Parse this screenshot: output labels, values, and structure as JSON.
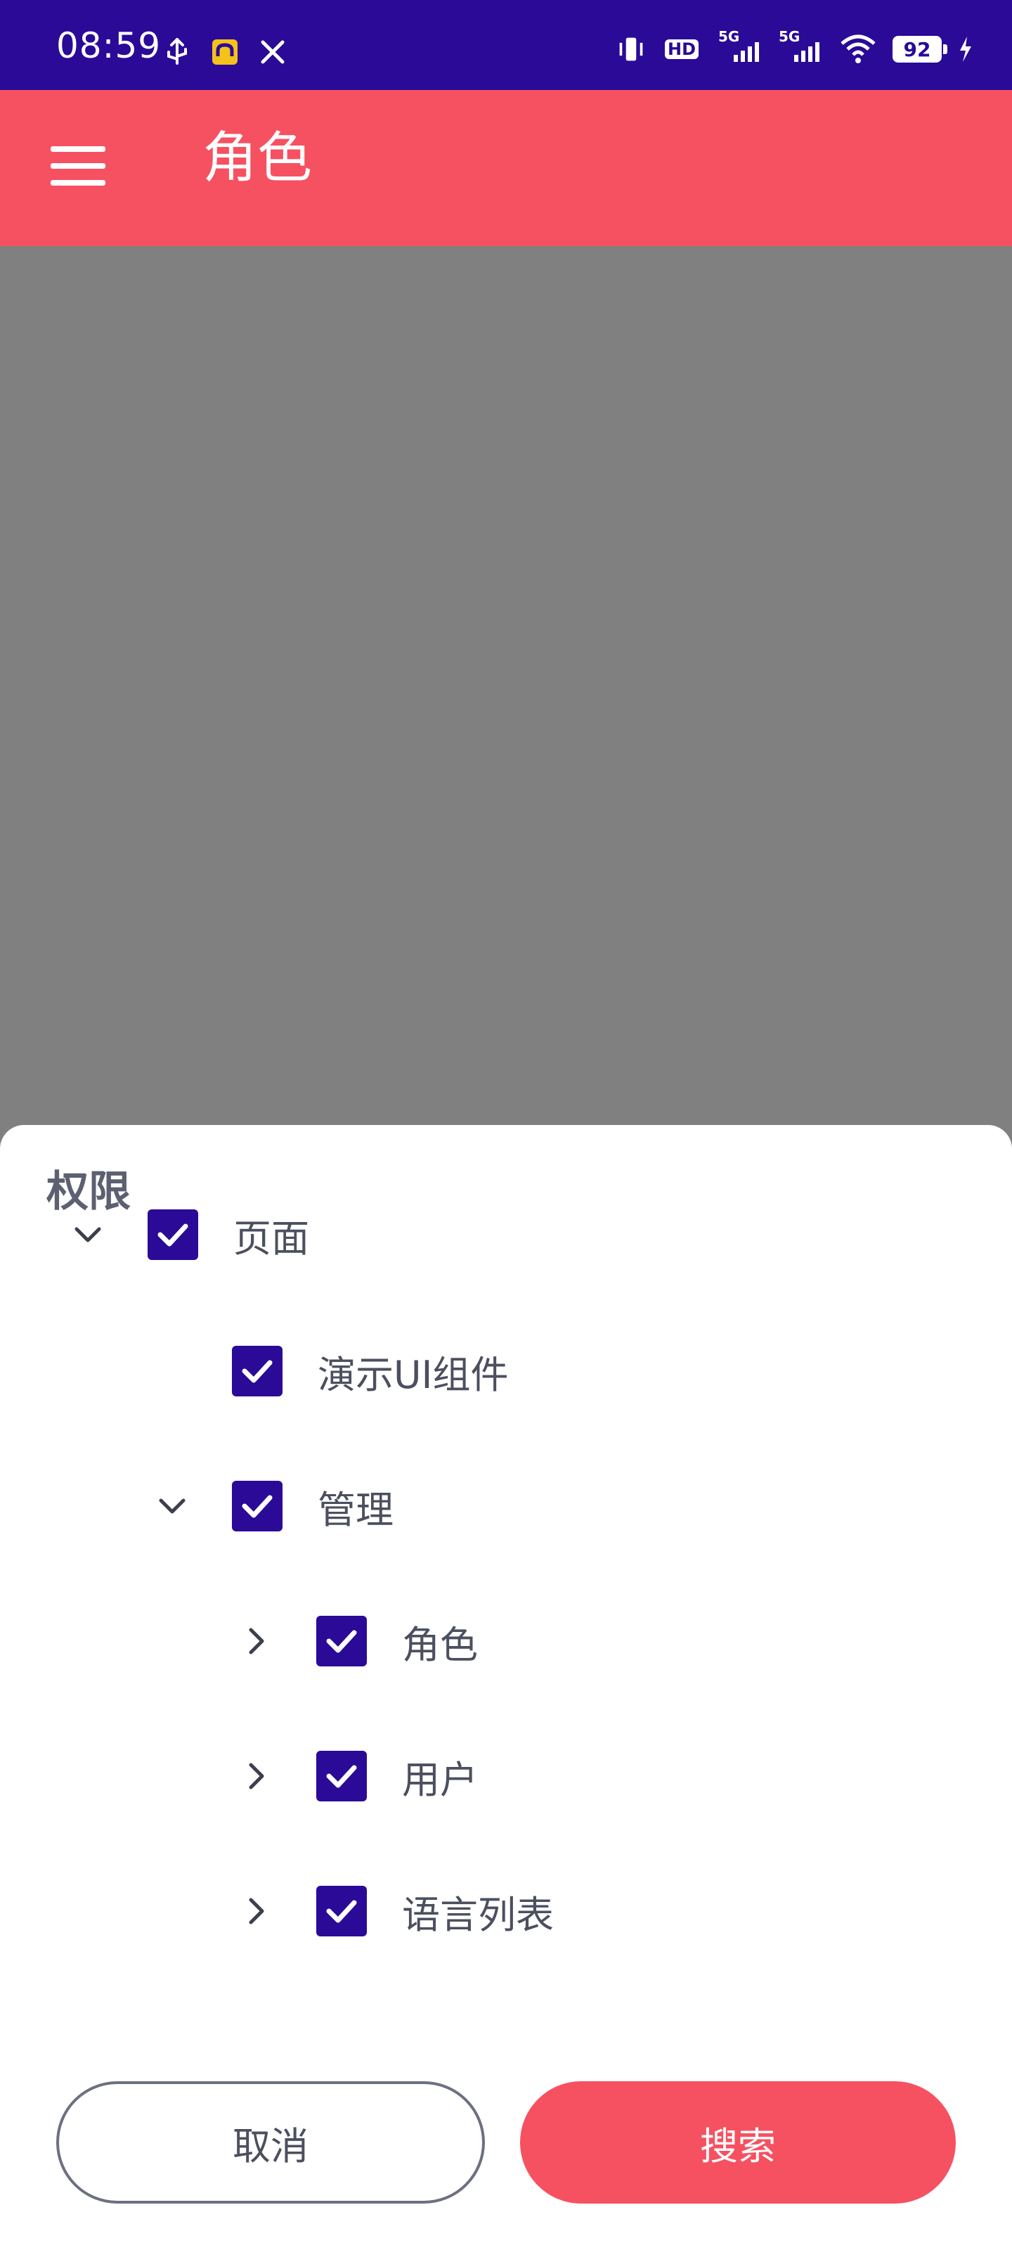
{
  "status_bar": {
    "time": "08:59",
    "battery": "92",
    "icons_left": [
      "usb-icon",
      "car-icon",
      "tools-icon"
    ],
    "icons_right": [
      "vibrate-icon",
      "hd-icon",
      "signal-5g-icon",
      "signal-5g-icon",
      "wifi-icon",
      "battery-icon",
      "charging-icon"
    ],
    "net1": "5G",
    "net2": "5G",
    "hd": "HD"
  },
  "app_bar": {
    "title": "角色",
    "bg_color": "#f65161"
  },
  "sheet": {
    "title": "权限",
    "tree": [
      {
        "label": "页面",
        "expanded": true,
        "has_children": true,
        "checked": true,
        "level": 0
      },
      {
        "label": "演示UI组件",
        "expanded": false,
        "has_children": false,
        "checked": true,
        "level": 1
      },
      {
        "label": "管理",
        "expanded": true,
        "has_children": true,
        "checked": true,
        "level": 1
      },
      {
        "label": "角色",
        "expanded": false,
        "has_children": true,
        "checked": true,
        "level": 2
      },
      {
        "label": "用户",
        "expanded": false,
        "has_children": true,
        "checked": true,
        "level": 2
      },
      {
        "label": "语言列表",
        "expanded": false,
        "has_children": true,
        "checked": true,
        "level": 2
      }
    ],
    "cancel_label": "取消",
    "search_label": "搜索"
  },
  "colors": {
    "status_bar": "#2a0a97",
    "accent": "#f65161",
    "checkbox": "#2a0a97"
  }
}
